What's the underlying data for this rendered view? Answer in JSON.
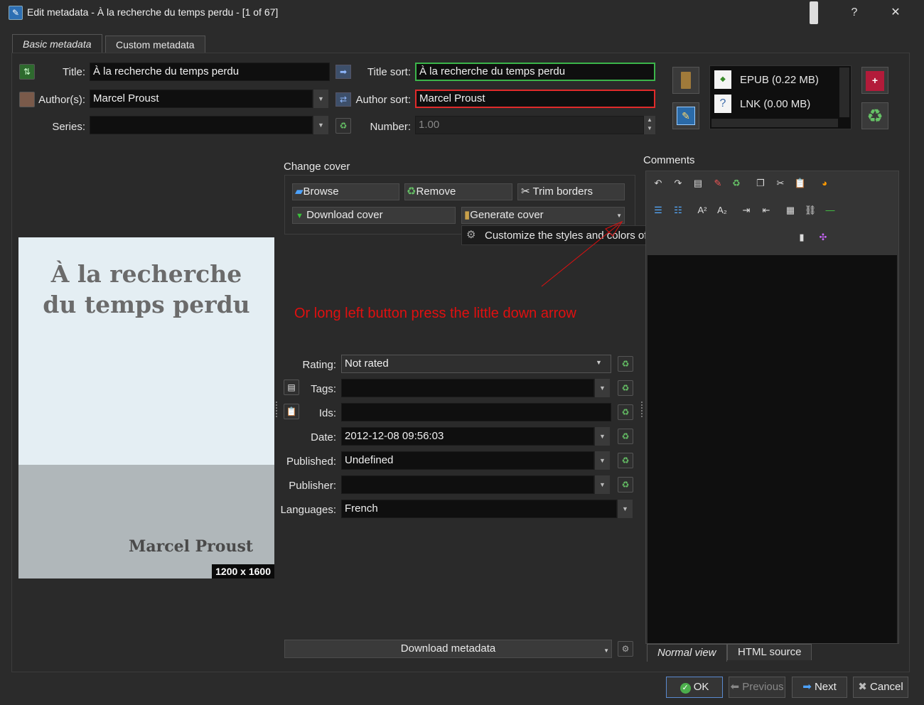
{
  "window": {
    "title": "Edit metadata - À la recherche du temps perdu -   [1 of 67]",
    "help_label": "?",
    "close_label": "✕"
  },
  "tabs": [
    {
      "label": "Basic metadata"
    },
    {
      "label": "Custom metadata"
    }
  ],
  "fields": {
    "title_label": "Title:",
    "title_value": "À la recherche du temps perdu",
    "title_sort_label": "Title sort:",
    "title_sort_value": "À la recherche du temps perdu",
    "authors_label": "Author(s):",
    "authors_value": "Marcel Proust",
    "author_sort_label": "Author sort:",
    "author_sort_value": "Marcel Proust",
    "series_label": "Series:",
    "series_value": "",
    "number_label": "Number:",
    "number_value": "1.00"
  },
  "formats": [
    {
      "label": "EPUB (0.22 MB)",
      "icon": "epub-icon"
    },
    {
      "label": "LNK (0.00 MB)",
      "icon": "unknown-file-icon"
    }
  ],
  "cover": {
    "section_label": "Change cover",
    "browse": "Browse",
    "remove": "Remove",
    "trim": "Trim borders",
    "download": "Download cover",
    "generate": "Generate cover",
    "tooltip": "Customize the styles and colors of the generated cover",
    "preview_title": "À la recherche du temps perdu",
    "preview_author": "Marcel Proust",
    "size_badge": "1200 x 1600",
    "top_color": "#e4eef3",
    "bottom_color": "#b0b7ba"
  },
  "annotation": {
    "text": "Or long left button press the little down arrow",
    "color": "#e01010"
  },
  "details": {
    "rating_label": "Rating:",
    "rating_value": "Not rated",
    "tags_label": "Tags:",
    "tags_value": "",
    "ids_label": "Ids:",
    "ids_value": "",
    "date_label": "Date:",
    "date_value": "2012-12-08 09:56:03",
    "published_label": "Published:",
    "published_value": "Undefined",
    "publisher_label": "Publisher:",
    "publisher_value": "",
    "languages_label": "Languages:",
    "languages_value": "French"
  },
  "download_metadata": "Download metadata",
  "comments": {
    "label": "Comments",
    "normal_view": "Normal view",
    "html_source": "HTML source"
  },
  "footer": {
    "ok": "OK",
    "previous": "Previous",
    "next": "Next",
    "cancel": "Cancel"
  }
}
